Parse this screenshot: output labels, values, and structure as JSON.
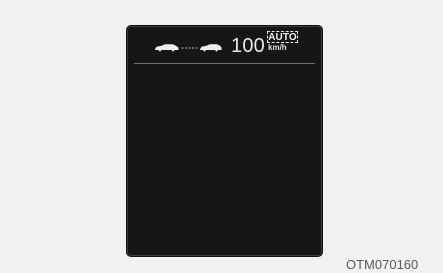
{
  "cluster": {
    "speed": "100",
    "mode": "AUTO",
    "unit": "km/h"
  },
  "caption": {
    "code": "OTM070160"
  },
  "icons": {
    "vehicle_distance": "vehicle-distance-icon"
  },
  "colors": {
    "background": "#f1f1f1",
    "panel": "#161616",
    "text": "#e6e6e6"
  }
}
